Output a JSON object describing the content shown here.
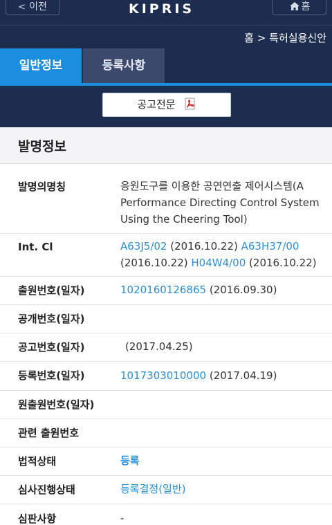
{
  "header": {
    "back_label": "이전",
    "logo": "KIPRIS",
    "home_label": "홈"
  },
  "breadcrumb": "홈 > 특허실용신안",
  "tabs": [
    {
      "label": "일반정보",
      "active": true
    },
    {
      "label": "등록사항",
      "active": false
    }
  ],
  "actions": {
    "announcement_label": "공고전문"
  },
  "section": {
    "title": "발명정보"
  },
  "rows": {
    "title": {
      "label": "발명의명칭",
      "value": "응원도구를 이용한 공연연출 제어시스템(A Performance Directing Control System Using the Cheering Tool)"
    },
    "ipc": {
      "label": "Int. Cl",
      "items": [
        {
          "code": "A63J5/02",
          "date": "(2016.10.22)"
        },
        {
          "code": "A63H37/00",
          "date": "(2016.10.22)"
        },
        {
          "code": "H04W4/00",
          "date": "(2016.10.22)"
        }
      ]
    },
    "application": {
      "label": "출원번호(일자)",
      "number": "1020160126865",
      "date": "(2016.09.30)"
    },
    "publication": {
      "label": "공개번호(일자)"
    },
    "announcement": {
      "label": "공고번호(일자)",
      "date": "(2017.04.25)"
    },
    "registration": {
      "label": "등록번호(일자)",
      "number": "1017303010000",
      "date": "(2017.04.19)"
    },
    "original_application": {
      "label": "원출원번호(일자)"
    },
    "related_application": {
      "label": "관련 출원번호"
    },
    "legal_status": {
      "label": "법적상태",
      "value": "등록"
    },
    "exam_status": {
      "label": "심사진행상태",
      "value": "등록결정(일반)"
    },
    "trial": {
      "label": "심판사항",
      "value": "-"
    }
  },
  "colors": {
    "navy": "#1d2d4f",
    "accent_blue": "#1c8ee0",
    "link_blue": "#2a8fd6"
  }
}
